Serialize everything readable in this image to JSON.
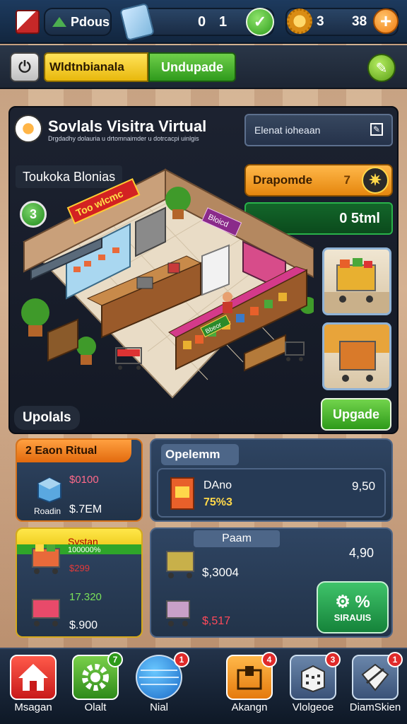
{
  "topbar": {
    "bonus_label": "Pdous",
    "center_value_left": "0",
    "center_value_right": "1",
    "coin_count": "3",
    "gem_count": "38",
    "check_icon": "check-icon",
    "plus_icon": "plus-icon"
  },
  "subbar": {
    "tab_yellow": "Wldtnbianala",
    "tab_green": "Undupade"
  },
  "header": {
    "title": "Sovlals Visitra Virtual",
    "subtitle": "Drgdadhy dolauria u drtomnaimder u dotrcacpi uinlgis"
  },
  "search": {
    "placeholder": "Elenat ioheaan"
  },
  "store": {
    "label": "Toukoka Blonias",
    "badge": "3",
    "sign_text": "Too wlcmc",
    "sign2_text": "Bloicd",
    "sign3_text": "Bbeor"
  },
  "side": {
    "orange_label": "Drapomde",
    "orange_value": "7",
    "green_value": "0 5tml",
    "upgrade_button": "Upgade"
  },
  "uploads_label": "Upolals",
  "cards": {
    "c1": {
      "title": "2 Eaon Ritual",
      "price1": "$0100",
      "name": "Roadin",
      "price2": "$.7EM"
    },
    "c2": {
      "title": "Opelemm",
      "item_name": "DAno",
      "item_pct": "75%3",
      "item_price": "9,50"
    },
    "c3": {
      "title": "Systan",
      "subtitle": "100000%",
      "v1": "$299",
      "v2": "17.320",
      "v3": "$.900"
    },
    "c4": {
      "title": "Paam",
      "price_right": "4,90",
      "price_mid": "$,3004",
      "price_red": "$,517",
      "sim_big": "⚙ %",
      "sim_small": "SIRAUIS"
    }
  },
  "nav": [
    {
      "label": "Msagan",
      "badge": ""
    },
    {
      "label": "Olalt",
      "badge": "7"
    },
    {
      "label": "Nial",
      "badge": "1"
    },
    {
      "label": "Akangn",
      "badge": "4"
    },
    {
      "label": "Vlolgeoe",
      "badge": "3"
    },
    {
      "label": "DiamSkien",
      "badge": "1"
    }
  ],
  "colors": {
    "accent_green": "#2e9a1a",
    "accent_orange": "#e5860e",
    "panel_dark": "#1c2230",
    "nav_dark": "#0e1826"
  }
}
